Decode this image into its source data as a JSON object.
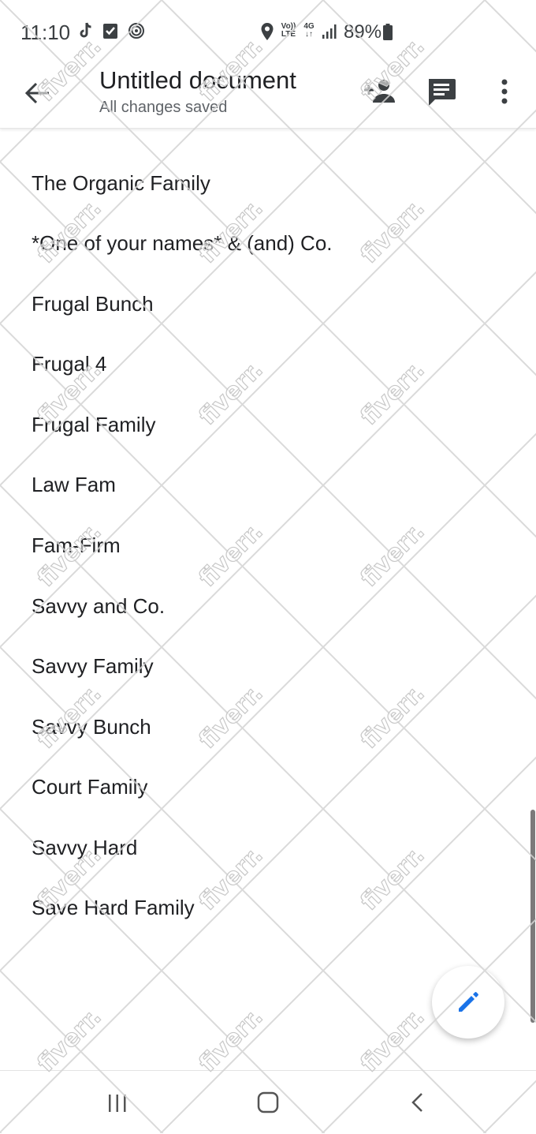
{
  "status_bar": {
    "time": "11:10",
    "battery": "89%",
    "network_4g": "4G",
    "volte_top": "Vo))",
    "volte_bottom": "LTE",
    "icons_left": [
      "tiktok-icon",
      "check-box-icon",
      "radar-icon"
    ],
    "icons_right": [
      "location-icon",
      "volte-icon",
      "data-arrows-icon",
      "signal-icon",
      "battery-icon"
    ]
  },
  "app_bar": {
    "title": "Untitled document",
    "subtitle": "All changes saved",
    "icons": [
      "back-arrow-icon",
      "add-person-icon",
      "comment-icon",
      "more-vert-icon"
    ]
  },
  "document": {
    "lines": [
      "The Organic Family",
      "*One of your names* & (and) Co.",
      "Frugal Bunch",
      "Frugal 4",
      "Frugal Family",
      "Law Fam",
      "Fam-Firm",
      "Savvy and Co.",
      "Savvy Family",
      "Savvy Bunch",
      "Court Family",
      "Savvy Hard",
      "Save Hard Family"
    ]
  },
  "fab": {
    "icon": "edit-pencil-icon",
    "color": "#1a73e8"
  },
  "nav_bar": {
    "icons": [
      "recent-apps-icon",
      "home-icon",
      "back-icon"
    ]
  },
  "watermark": {
    "text": "fiverr."
  },
  "colors": {
    "text": "#202124",
    "secondary_text": "#5f6368",
    "accent": "#1a73e8",
    "icon": "#3c4043"
  }
}
